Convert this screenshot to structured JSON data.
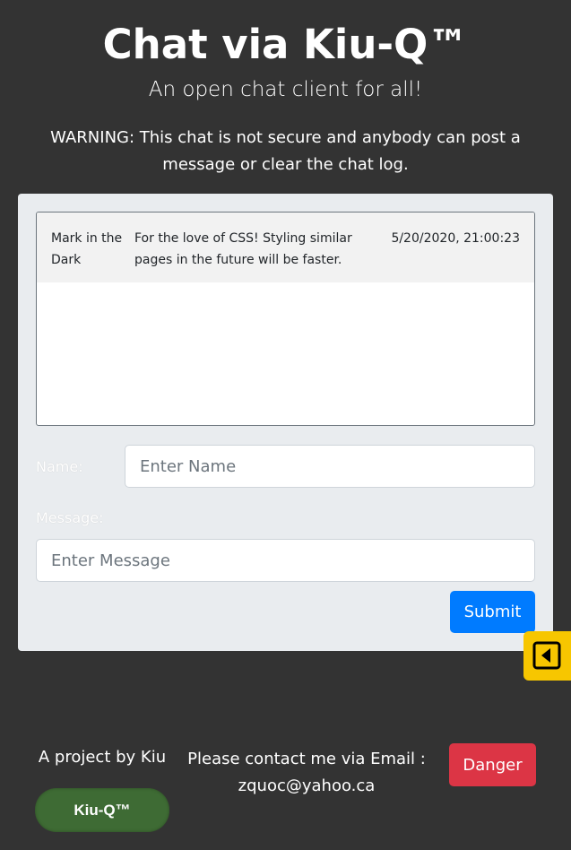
{
  "header": {
    "title": "Chat via Kiu-Q™",
    "subtitle": "An open chat client for all!",
    "warning": "WARNING: This chat is not secure and anybody can post a message or clear the chat log."
  },
  "chat_log": {
    "messages": [
      {
        "name": "Mark in the Dark",
        "text": "For the love of CSS! Styling similar pages in the future will be faster.",
        "timestamp": "5/20/2020, 21:00:23"
      }
    ]
  },
  "form": {
    "name_label": "Name:",
    "name_placeholder": "Enter Name",
    "message_label": "Message:",
    "message_placeholder": "Enter Message",
    "submit_label": "Submit"
  },
  "side_tab": {
    "icon": "caret-left-square-icon"
  },
  "footer": {
    "project_text": "A project by Kiu",
    "badge_label": "Kiu-Q™",
    "contact_text": "Please contact me via Email :",
    "email": "zquoc@yahoo.ca",
    "danger_label": "Danger"
  },
  "colors": {
    "background": "#333333",
    "card": "#e9ecef",
    "primary": "#007bff",
    "danger": "#dc3545",
    "badge": "#3e6b34",
    "side_tab": "#f7c600"
  }
}
